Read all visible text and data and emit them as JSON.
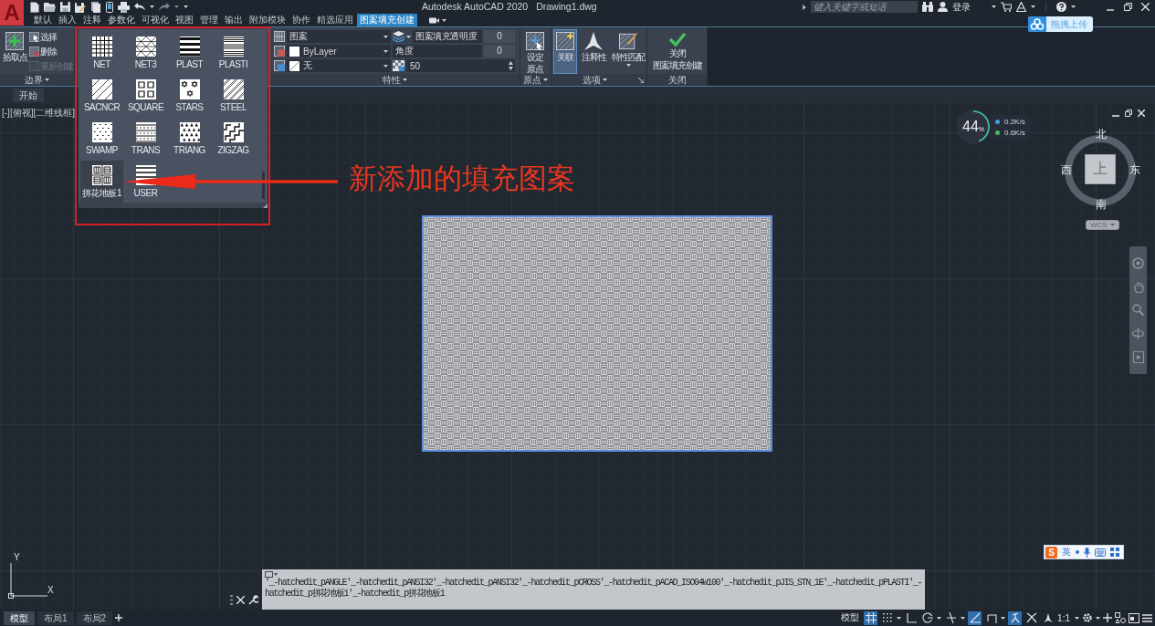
{
  "app_menu": {
    "label": "A"
  },
  "title_bar": {
    "app_title": "Autodesk AutoCAD 2020",
    "document": "Drawing1.dwg",
    "search": {
      "placeholder": "键入关键字或短语"
    },
    "sign_in": "登录"
  },
  "ribbon_tabs": [
    {
      "label": "默认",
      "selected": false
    },
    {
      "label": "插入",
      "selected": false
    },
    {
      "label": "注释",
      "selected": false
    },
    {
      "label": "参数化",
      "selected": false
    },
    {
      "label": "可视化",
      "selected": false
    },
    {
      "label": "视图",
      "selected": false
    },
    {
      "label": "管理",
      "selected": false
    },
    {
      "label": "输出",
      "selected": false
    },
    {
      "label": "附加模块",
      "selected": false
    },
    {
      "label": "协作",
      "selected": false
    },
    {
      "label": "精选应用",
      "selected": false
    },
    {
      "label": "图案填充创建",
      "selected": true
    }
  ],
  "upload_badge": {
    "label": "拖拽上传"
  },
  "ribbon": {
    "boundary": {
      "title": "边界",
      "pick_button": "拾取点",
      "actions": [
        {
          "label": "选择",
          "disabled": false
        },
        {
          "label": "删除",
          "disabled": false
        },
        {
          "label": "重新创建",
          "disabled": true
        }
      ]
    },
    "properties": {
      "title": "特性",
      "pattern_type": "图案",
      "color_mode": "ByLayer",
      "background": "无",
      "transparency_label": "图案填充透明度",
      "transparency": "0",
      "angle_label": "角度",
      "angle": "0",
      "scale": "50"
    },
    "origin": {
      "title": "原点",
      "button_lines": [
        "设定",
        "原点"
      ]
    },
    "options": {
      "title": "选项",
      "buttons": [
        {
          "label": "关联",
          "selected": true
        },
        {
          "label": "注释性",
          "selected": false
        },
        {
          "label": "特性匹配",
          "selected": false
        }
      ]
    },
    "close": {
      "title": "关闭",
      "button_lines": [
        "关闭",
        "图案填充创建"
      ]
    }
  },
  "pattern_gallery": {
    "patterns": [
      {
        "name": "NET",
        "selected": false
      },
      {
        "name": "NET3",
        "selected": false
      },
      {
        "name": "PLAST",
        "selected": false
      },
      {
        "name": "PLASTI",
        "selected": false
      },
      {
        "name": "SACNCR",
        "selected": false
      },
      {
        "name": "SQUARE",
        "selected": false
      },
      {
        "name": "STARS",
        "selected": false
      },
      {
        "name": "STEEL",
        "selected": false
      },
      {
        "name": "SWAMP",
        "selected": false
      },
      {
        "name": "TRANS",
        "selected": false
      },
      {
        "name": "TRIANG",
        "selected": false
      },
      {
        "name": "ZIGZAG",
        "selected": false
      },
      {
        "name": "拼花地板1",
        "selected": true
      },
      {
        "name": "USER",
        "selected": false
      }
    ]
  },
  "annotation": {
    "text": "新添加的填充图案"
  },
  "file_tabs": [
    {
      "label": "开始"
    }
  ],
  "viewport": {
    "label": "[-][俯视][二维线框]"
  },
  "network_monitor": {
    "percent": "44",
    "unit": "%",
    "level": 0.44,
    "rates": [
      {
        "value": "0.2K/s",
        "color": "#3ba3e0"
      },
      {
        "value": "0.6K/s",
        "color": "#3fbf5a"
      }
    ]
  },
  "view_cube": {
    "north": "北",
    "west": "西",
    "east": "东",
    "south": "南",
    "face": "上",
    "ucs": "WCS"
  },
  "ucs_icon": {
    "y": "Y",
    "x": "X"
  },
  "command_line": {
    "history": [
      "'_-hatchedit_pANGLE'_-hatchedit_pANSI32'_-hatchedit_pANSI32'_-hatchedit_pCROSS'_-hatchedit_pACAD_ISO04W100'_-hatchedit_pJIS_STN_1E'_-hatchedit_pPLASTI'_-",
      "hatchedit_p拼花地板1'_-hatchedit_p拼花地板1"
    ]
  },
  "ime_bar": {
    "logo": "S",
    "mode": "英"
  },
  "layout_tabs": [
    {
      "label": "模型",
      "selected": true
    },
    {
      "label": "布局1",
      "selected": false
    },
    {
      "label": "布局2",
      "selected": false
    }
  ],
  "status_bar": {
    "space": "模型",
    "toggles": [
      {
        "on": true
      },
      {
        "on": false
      },
      {
        "on": false
      },
      {
        "on": false
      },
      {
        "on": false
      },
      {
        "on": true
      },
      {
        "on": false
      },
      {
        "on": true
      },
      {
        "on": false
      },
      {
        "on": false
      }
    ],
    "scale": "1:1"
  }
}
